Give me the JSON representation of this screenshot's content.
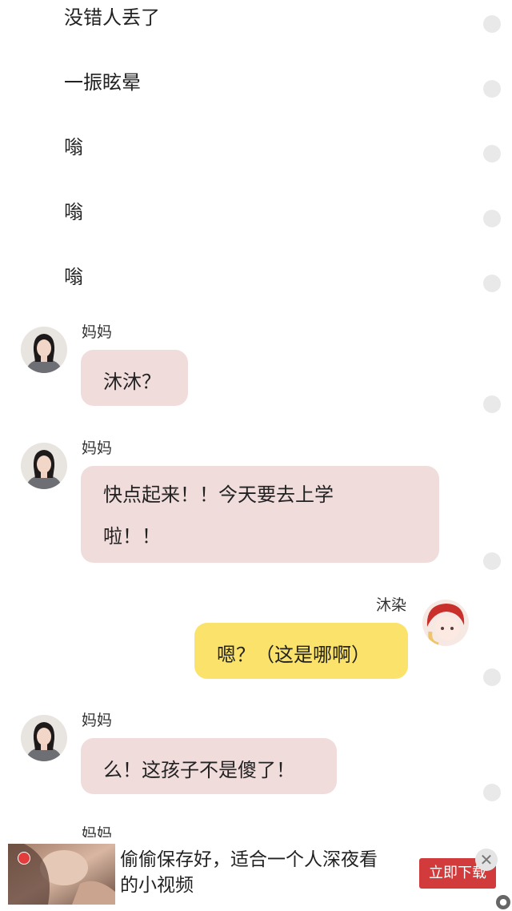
{
  "narration_lines": [
    "没错人丢了",
    "一振眩晕",
    "嗡",
    "嗡",
    "嗡"
  ],
  "messages": [
    {
      "sender": "妈妈",
      "lines": [
        "沐沐？"
      ]
    },
    {
      "sender": "妈妈",
      "lines": [
        "快点起来！！今天要去上学",
        "啦！！"
      ]
    },
    {
      "sender": "沐染",
      "lines": [
        "嗯？（这是哪啊）"
      ]
    },
    {
      "sender": "妈妈",
      "lines": [
        "么！这孩子不是傻了！"
      ]
    },
    {
      "sender": "妈妈"
    }
  ],
  "ad": {
    "text_lines": [
      "偷偷保存好，适合一个人深夜看",
      "的小视频"
    ],
    "cta_label": "立即下载",
    "close_glyph": "✕"
  },
  "colors": {
    "mom_bubble": "#f1dcdc",
    "self_bubble": "#fbe26a",
    "ad_button": "#d23b3b"
  }
}
